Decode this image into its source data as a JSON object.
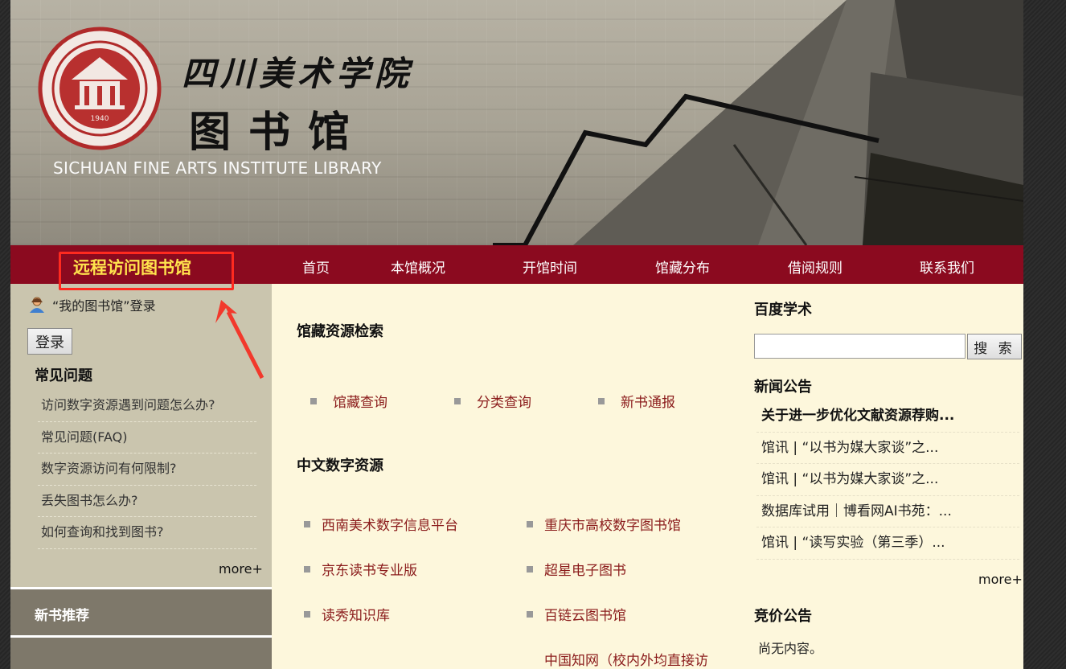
{
  "banner": {
    "college_name": "四川美术学院",
    "library_name": "图书馆",
    "english_name": "SICHUAN FINE ARTS INSTITUTE LIBRARY",
    "seal_year": "1940",
    "logo_icon": "library-seal-logo"
  },
  "nav": {
    "remote_access": "远程访问图书馆",
    "items": [
      "首页",
      "本馆概况",
      "开馆时间",
      "馆藏分布",
      "借阅规则",
      "联系我们"
    ],
    "bg_color": "#8b0a1f",
    "highlight_color": "#ffe34d"
  },
  "sidebar": {
    "login_prompt": "“我的图书馆”登录",
    "login_button": "登录",
    "faq_title": "常见问题",
    "faq_items": [
      "访问数字资源遇到问题怎么办?",
      "常见问题(FAQ)",
      "数字资源访问有何限制?",
      "丢失图书怎么办?",
      "如何查询和找到图书?"
    ],
    "faq_more": "more+",
    "new_books_title": "新书推荐"
  },
  "main": {
    "catalog_title": "馆藏资源检索",
    "catalog_links": [
      "馆藏查询",
      "分类查询",
      "新书通报"
    ],
    "chinese_db_title": "中文数字资源",
    "chinese_db_links": [
      "西南美术数字信息平台",
      "重庆市高校数字图书馆",
      "京东读书专业版",
      "超星电子图书",
      "读秀知识库",
      "百链云图书馆",
      "中国知网（校内外均直接访"
    ]
  },
  "right": {
    "baidu_title": "百度学术",
    "search_value": "",
    "search_button": "搜 索",
    "news_title": "新闻公告",
    "news_items": [
      "关于进一步优化文献资源荐购...",
      "馆讯 | “以书为媒大家谈”之...",
      "馆讯 | “以书为媒大家谈”之...",
      "数据库试用｜博看网AI书苑：...",
      "馆讯 | “读写实验（第三季）..."
    ],
    "news_more": "more+",
    "bid_title": "竞价公告",
    "bid_empty": "尚无内容。"
  }
}
